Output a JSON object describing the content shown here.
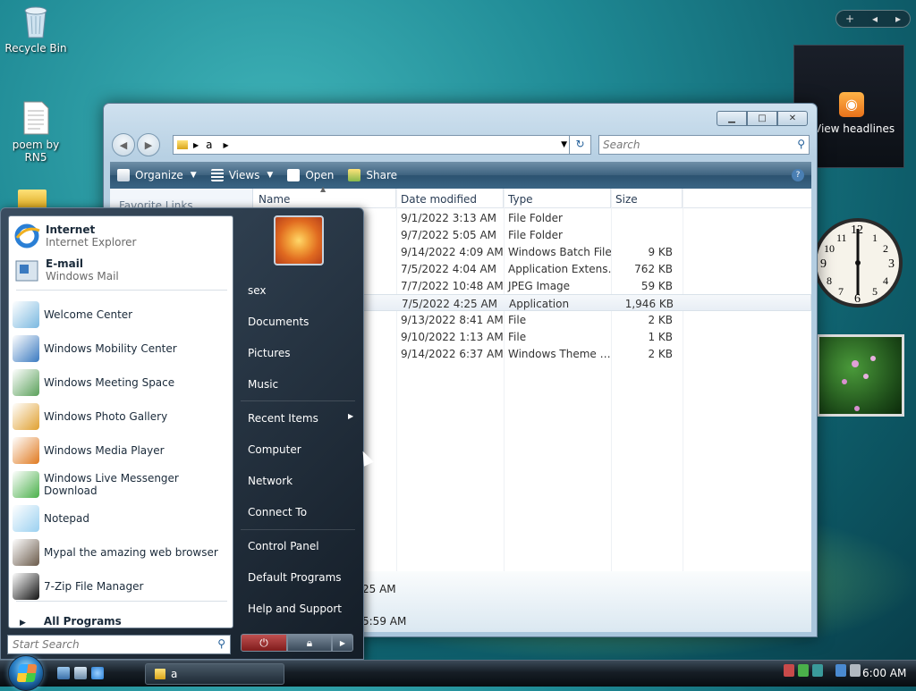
{
  "desktop": {
    "icons": [
      {
        "label": "Recycle Bin",
        "icon": "recycle-bin-icon"
      },
      {
        "label": "poem by RN5",
        "icon": "text-file-icon"
      }
    ]
  },
  "sidebar": {
    "controls": [
      "+",
      "◂",
      "▸"
    ],
    "feed_headline": "View headlines"
  },
  "explorer": {
    "address_folder": "a",
    "search_placeholder": "Search",
    "toolbar": {
      "organize": "Organize",
      "views": "Views",
      "open": "Open",
      "share": "Share"
    },
    "favorite_links": "Favorite Links",
    "columns": {
      "name": "Name",
      "date": "Date modified",
      "type": "Type",
      "size": "Size"
    },
    "rows": [
      {
        "date": "9/1/2022 3:13 AM",
        "type": "File Folder",
        "size": ""
      },
      {
        "date": "9/7/2022 5:05 AM",
        "type": "File Folder",
        "size": ""
      },
      {
        "date": "9/14/2022 4:09 AM",
        "type": "Windows Batch File",
        "size": "9 KB"
      },
      {
        "date": "7/5/2022 4:04 AM",
        "type": "Application Extens…",
        "size": "762 KB"
      },
      {
        "date": "7/7/2022 10:48 AM",
        "type": "JPEG Image",
        "size": "59 KB"
      },
      {
        "date": "7/5/2022 4:25 AM",
        "type": "Application",
        "size": "1,946 KB"
      },
      {
        "date": "9/13/2022 8:41 AM",
        "type": "File",
        "size": "2 KB"
      },
      {
        "date": "9/10/2022 1:13 AM",
        "type": "File",
        "size": "1 KB"
      },
      {
        "date": "9/14/2022 6:37 AM",
        "type": "Windows Theme …",
        "size": "2 KB"
      }
    ],
    "details_line1": "25 AM",
    "details_line2": "5:59 AM"
  },
  "start_menu": {
    "pinned": [
      {
        "title": "Internet",
        "subtitle": "Internet Explorer",
        "icon": "internet-explorer-icon"
      },
      {
        "title": "E-mail",
        "subtitle": "Windows Mail",
        "icon": "windows-mail-icon"
      }
    ],
    "recent": [
      {
        "label": "Welcome Center",
        "icon": "welcome-center-icon"
      },
      {
        "label": "Windows Mobility Center",
        "icon": "mobility-center-icon"
      },
      {
        "label": "Windows Meeting Space",
        "icon": "meeting-space-icon"
      },
      {
        "label": "Windows Photo Gallery",
        "icon": "photo-gallery-icon"
      },
      {
        "label": "Windows Media Player",
        "icon": "media-player-icon"
      },
      {
        "label": "Windows Live Messenger Download",
        "icon": "messenger-icon"
      },
      {
        "label": "Notepad",
        "icon": "notepad-icon"
      },
      {
        "label": "Mypal the amazing web browser",
        "icon": "mypal-icon"
      },
      {
        "label": "7-Zip File Manager",
        "icon": "7zip-icon"
      }
    ],
    "all_programs": "All Programs",
    "search_placeholder": "Start Search",
    "right": {
      "user": "sex",
      "documents": "Documents",
      "pictures": "Pictures",
      "music": "Music",
      "recent_items": "Recent Items",
      "computer": "Computer",
      "network": "Network",
      "connect_to": "Connect To",
      "control_panel": "Control Panel",
      "default_programs": "Default Programs",
      "help_support": "Help and Support"
    }
  },
  "taskbar": {
    "window_a": "a",
    "clock": "6:00 AM"
  }
}
